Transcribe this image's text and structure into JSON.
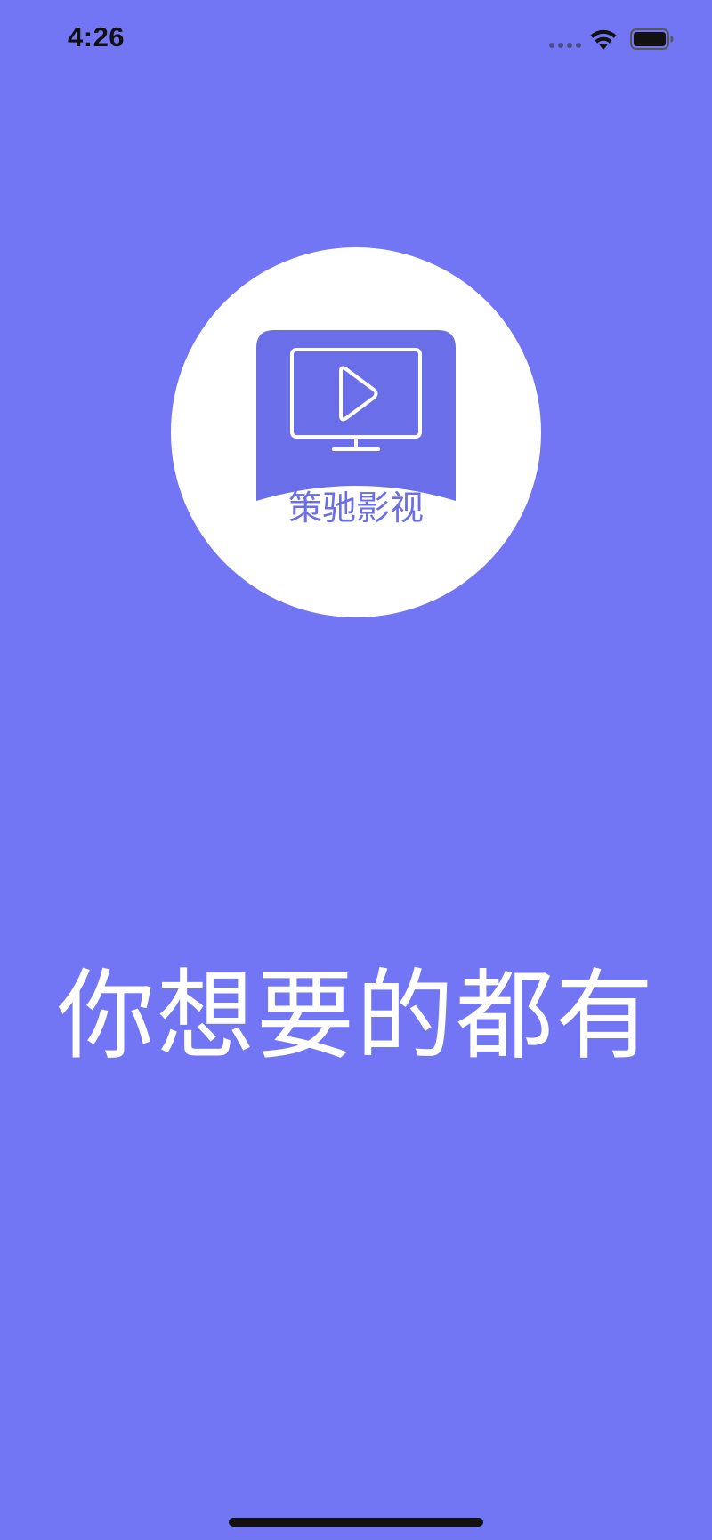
{
  "status_bar": {
    "time": "4:26",
    "icons": [
      "cellular-signal-icon",
      "wifi-icon",
      "battery-icon"
    ]
  },
  "logo": {
    "brand_name": "策驰影视",
    "icon": "tv-play-icon"
  },
  "splash": {
    "tagline": "你想要的都有"
  },
  "colors": {
    "background": "#7276f4",
    "logo_circle": "#ffffff",
    "logo_mark": "#6a6ee8",
    "tagline_text": "#ffffff"
  }
}
